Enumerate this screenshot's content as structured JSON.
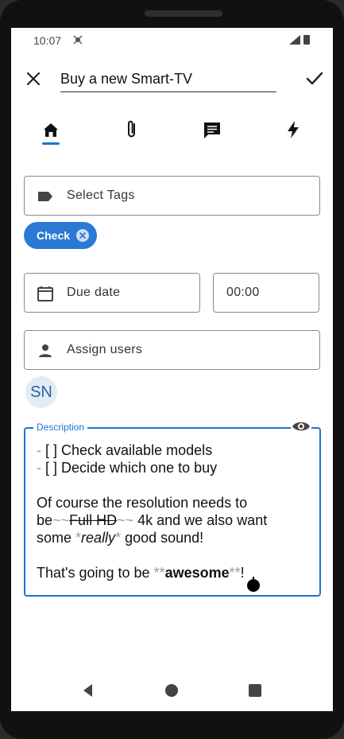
{
  "status_bar": {
    "time": "10:07"
  },
  "app_bar": {
    "title_value": "Buy a new Smart-TV"
  },
  "tabs": [
    {
      "icon": "home-icon"
    },
    {
      "icon": "paperclip-icon"
    },
    {
      "icon": "comment-icon"
    },
    {
      "icon": "lightning-icon"
    }
  ],
  "tags": {
    "placeholder": "Select Tags",
    "chips": [
      {
        "label": "Check"
      }
    ]
  },
  "due": {
    "date_label": "Due date",
    "time_value": "00:00"
  },
  "assign": {
    "label": "Assign users",
    "avatar_initials": "SN"
  },
  "description": {
    "label": "Description",
    "lines": {
      "l1_marker": "- ",
      "l1_text": "[ ] Check available models",
      "l2_marker": "- ",
      "l2_text": "[ ] Decide which one to buy",
      "l3": "Of course the resolution needs to",
      "l4_start": "be",
      "l4_tilde1": "~~",
      "l4_strike": "Full HD",
      "l4_tilde2": "~~",
      "l4_end": "  4k and we also want",
      "l5_start": "some ",
      "l5_star1": "*",
      "l5_em": "really",
      "l5_star2": "*",
      "l5_end": " good sound!",
      "l6_start": "That's going to be ",
      "l6_star1": "**",
      "l6_bold": "awesome",
      "l6_star2": "**",
      "l6_end": "!"
    }
  },
  "colors": {
    "accent": "#1976d2",
    "chip": "#2a79d4"
  }
}
